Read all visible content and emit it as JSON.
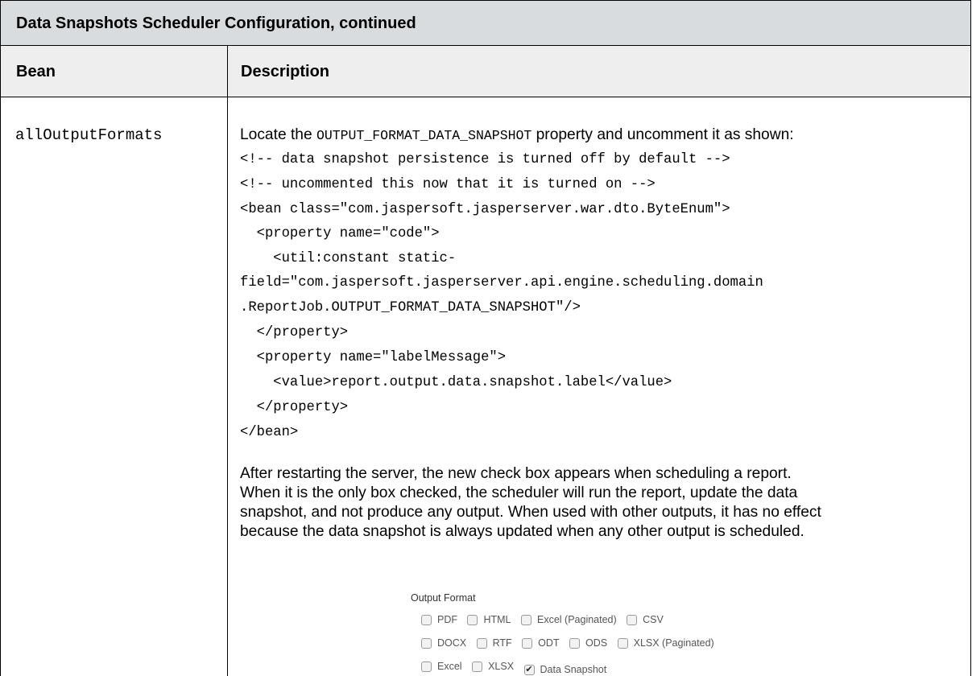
{
  "title": "Data Snapshots Scheduler Configuration, continued",
  "headers": {
    "bean": "Bean",
    "description": "Description"
  },
  "row": {
    "bean": "allOutputFormats",
    "intro": {
      "before": "Locate the ",
      "code": "OUTPUT_FORMAT_DATA_SNAPSHOT",
      "after": " property and uncomment it as shown:"
    },
    "code_lines": [
      "<!-- data snapshot persistence is turned off by default -->",
      "<!-- uncommented this now that it is turned on -->",
      "<bean class=\"com.jaspersoft.jasperserver.war.dto.ByteEnum\">",
      "  <property name=\"code\">",
      "    <util:constant static-",
      "field=\"com.jaspersoft.jasperserver.api.engine.scheduling.domain",
      ".ReportJob.OUTPUT_FORMAT_DATA_SNAPSHOT\"/>",
      "  </property>",
      "  <property name=\"labelMessage\">",
      "    <value>report.output.data.snapshot.label</value>",
      "  </property>",
      "</bean>"
    ],
    "paragraph_lines": [
      "After restarting the server, the new check box appears when scheduling a report.",
      "When it is the only box checked, the scheduler will run the report, update the data",
      "snapshot, and not produce any output. When used with other outputs, it has no effect",
      "because the data snapshot is always updated when any other output is scheduled."
    ],
    "output_format": {
      "title": "Output Format",
      "rows": [
        [
          {
            "label": "PDF",
            "checked": false
          },
          {
            "label": "HTML",
            "checked": false
          },
          {
            "label": "Excel (Paginated)",
            "checked": false
          },
          {
            "label": "CSV",
            "checked": false
          }
        ],
        [
          {
            "label": "DOCX",
            "checked": false
          },
          {
            "label": "RTF",
            "checked": false
          },
          {
            "label": "ODT",
            "checked": false
          },
          {
            "label": "ODS",
            "checked": false
          },
          {
            "label": "XLSX (Paginated)",
            "checked": false
          }
        ],
        [
          {
            "label": "Excel",
            "checked": false
          },
          {
            "label": "XLSX",
            "checked": false
          },
          {
            "label": "Data Snapshot",
            "checked": true
          }
        ]
      ]
    }
  }
}
